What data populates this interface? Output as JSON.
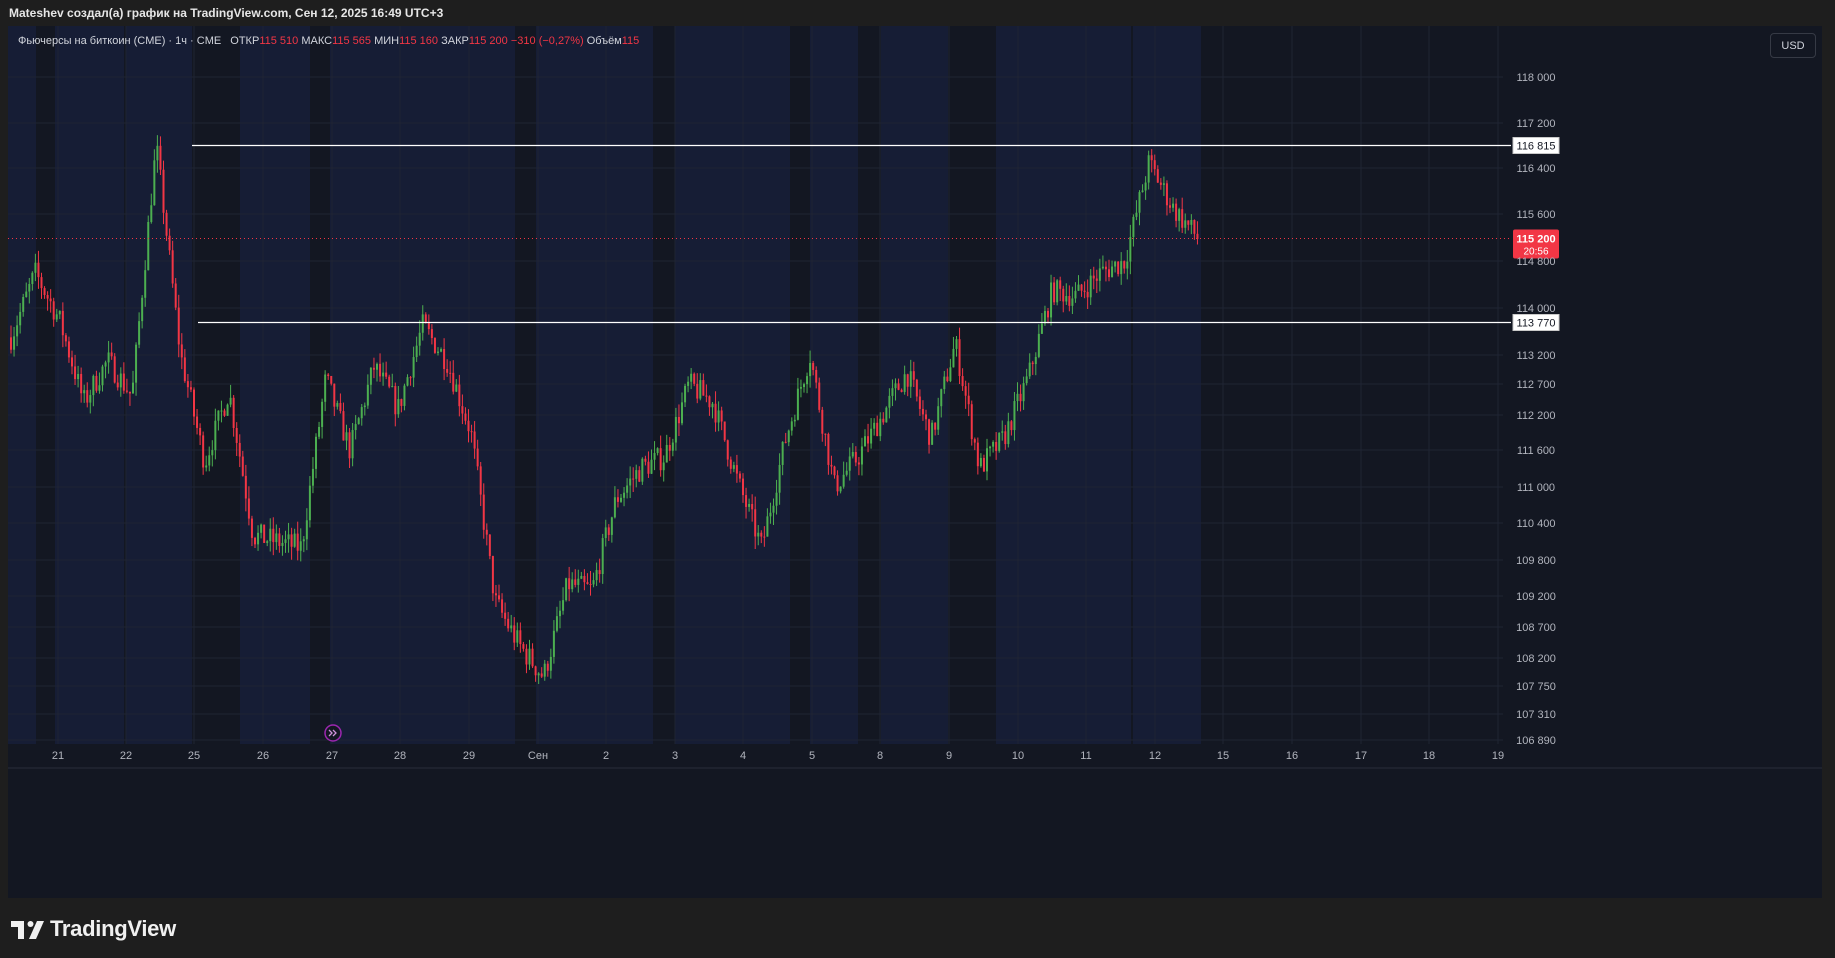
{
  "caption": "Mateshev создал(а) график на TradingView.com, Сен 12, 2025 16:49 UTC+3",
  "legend": {
    "symbol": "Фьючерсы на биткоин (CME) · 1ч · CME",
    "open_label": "ОТКР",
    "open_value": "115 510",
    "high_label": "МАКС",
    "high_value": "115 565",
    "low_label": "МИН",
    "low_value": "115 160",
    "close_label": "ЗАКР",
    "close_value": "115 200",
    "change": "−310 (−0,27%)",
    "volume_label": "Объём",
    "volume_value": "115"
  },
  "currency": "USD",
  "brand": "TradingView",
  "colors": {
    "up": "#4caf50",
    "down": "#f23645",
    "background": "#131722",
    "session_band": "#161d35",
    "price_label_bg": "#f23645",
    "level_line": "#ffffff"
  },
  "chart_data": {
    "type": "candlestick",
    "instrument": "Фьючерсы на биткоин (CME)",
    "timeframe": "1ч",
    "x_ticks": [
      "21",
      "22",
      "25",
      "26",
      "27",
      "28",
      "29",
      "Сен",
      "2",
      "3",
      "4",
      "5",
      "8",
      "9",
      "10",
      "11",
      "12",
      "15",
      "16",
      "17",
      "18",
      "19"
    ],
    "y_ticks": [
      "118 000",
      "117 200",
      "116 400",
      "115 600",
      "114 800",
      "114 000",
      "113 200",
      "112 700",
      "112 200",
      "111 600",
      "111 000",
      "110 400",
      "109 800",
      "109 200",
      "108 700",
      "108 200",
      "107 750",
      "107 310",
      "106 890"
    ],
    "y_tick_values": [
      118000,
      117200,
      116400,
      115600,
      114800,
      114000,
      113200,
      112700,
      112200,
      111600,
      111000,
      110400,
      109800,
      109200,
      108700,
      108200,
      107750,
      107310,
      106890
    ],
    "ylim": [
      106700,
      118800
    ],
    "horizontal_levels": [
      {
        "label": "116 815",
        "value": 116815
      },
      {
        "label": "113 770",
        "value": 113770
      }
    ],
    "last_price": {
      "label": "115 200",
      "value": 115200,
      "countdown": "20:56"
    },
    "close_path": [
      {
        "x": "21",
        "close": 113500
      },
      {
        "x": "21",
        "close": 114600
      },
      {
        "x": "22",
        "close": 113800
      },
      {
        "x": "22",
        "close": 112400
      },
      {
        "x": "22",
        "close": 113100
      },
      {
        "x": "22",
        "close": 112500
      },
      {
        "x": "25",
        "close": 116800
      },
      {
        "x": "25",
        "close": 113200
      },
      {
        "x": "26",
        "close": 111400
      },
      {
        "x": "26",
        "close": 112600
      },
      {
        "x": "26",
        "close": 110200
      },
      {
        "x": "27",
        "close": 110100
      },
      {
        "x": "27",
        "close": 110000
      },
      {
        "x": "27",
        "close": 112800
      },
      {
        "x": "28",
        "close": 111600
      },
      {
        "x": "28",
        "close": 113000
      },
      {
        "x": "28",
        "close": 112300
      },
      {
        "x": "29",
        "close": 113700
      },
      {
        "x": "29",
        "close": 113100
      },
      {
        "x": "29",
        "close": 111900
      },
      {
        "x": "Сен",
        "close": 109100
      },
      {
        "x": "Сен",
        "close": 108400
      },
      {
        "x": "Сен",
        "close": 107900
      },
      {
        "x": "2",
        "close": 109400
      },
      {
        "x": "2",
        "close": 109300
      },
      {
        "x": "2",
        "close": 110800
      },
      {
        "x": "3",
        "close": 111300
      },
      {
        "x": "3",
        "close": 111500
      },
      {
        "x": "4",
        "close": 112700
      },
      {
        "x": "4",
        "close": 112400
      },
      {
        "x": "5",
        "close": 111100
      },
      {
        "x": "5",
        "close": 110000
      },
      {
        "x": "5",
        "close": 111800
      },
      {
        "x": "8",
        "close": 113200
      },
      {
        "x": "8",
        "close": 111000
      },
      {
        "x": "8",
        "close": 111500
      },
      {
        "x": "9",
        "close": 112200
      },
      {
        "x": "9",
        "close": 112900
      },
      {
        "x": "9",
        "close": 111800
      },
      {
        "x": "9",
        "close": 113400
      },
      {
        "x": "10",
        "close": 111300
      },
      {
        "x": "10",
        "close": 111800
      },
      {
        "x": "10",
        "close": 112800
      },
      {
        "x": "11",
        "close": 114300
      },
      {
        "x": "11",
        "close": 114200
      },
      {
        "x": "11",
        "close": 114600
      },
      {
        "x": "12",
        "close": 114800
      },
      {
        "x": "12",
        "close": 116500
      },
      {
        "x": "12",
        "close": 115700
      },
      {
        "x": "12",
        "close": 115200
      }
    ]
  }
}
